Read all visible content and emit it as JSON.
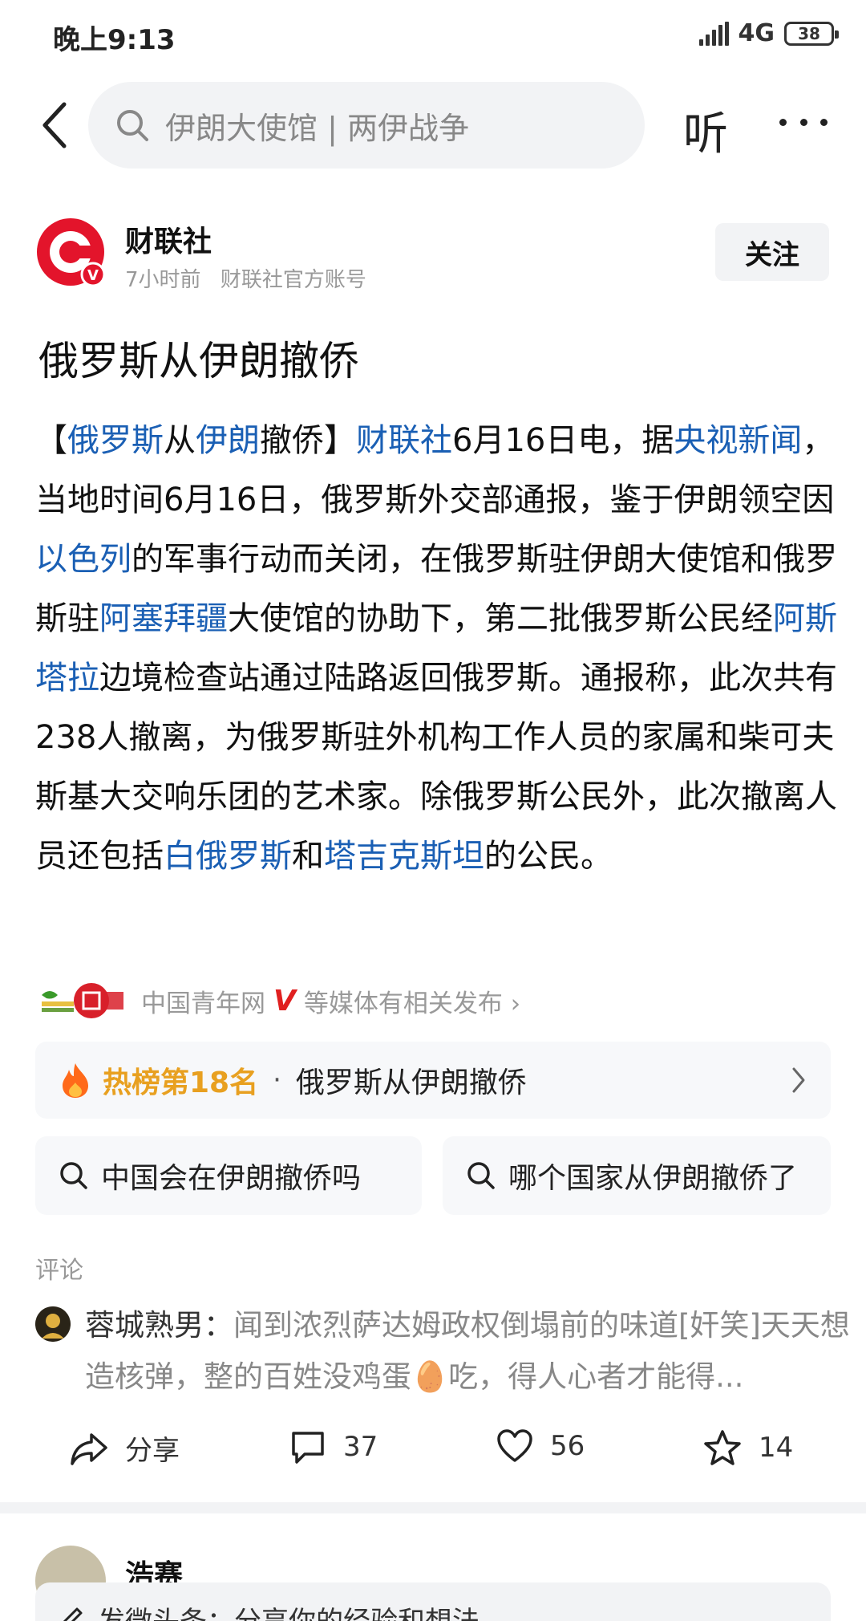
{
  "status_bar": {
    "time": "晚上9:13",
    "network": "4G",
    "battery": "38"
  },
  "top_bar": {
    "search_text": "伊朗大使馆 | 两伊战争",
    "listen_label": "听"
  },
  "author": {
    "name": "财联社",
    "time": "7小时前",
    "account_type": "财联社官方账号",
    "follow_label": "关注",
    "brand_color": "#e3142b"
  },
  "article": {
    "title": "俄罗斯从伊朗撤侨",
    "segments": [
      {
        "text": "【",
        "link": false
      },
      {
        "text": "俄罗斯",
        "link": true
      },
      {
        "text": "从",
        "link": false
      },
      {
        "text": "伊朗",
        "link": true
      },
      {
        "text": "撤侨】",
        "link": false
      },
      {
        "text": "财联社",
        "link": true
      },
      {
        "text": "6月16日电，据",
        "link": false
      },
      {
        "text": "央视新闻",
        "link": true
      },
      {
        "text": "，当地时间6月16日，俄罗斯外交部通报，鉴于伊朗领空因",
        "link": false
      },
      {
        "text": "以色列",
        "link": true
      },
      {
        "text": "的军事行动而关闭，在俄罗斯驻伊朗大使馆和俄罗斯驻",
        "link": false
      },
      {
        "text": "阿塞拜疆",
        "link": true
      },
      {
        "text": "大使馆的协助下，第二批俄罗斯公民经",
        "link": false
      },
      {
        "text": "阿斯塔拉",
        "link": true
      },
      {
        "text": "边境检查站通过陆路返回俄罗斯。通报称，此次共有238人撤离，为俄罗斯驻外机构工作人员的家属和柴可夫斯基大交响乐团的艺术家。除俄罗斯公民外，此次撤离人员还包括",
        "link": false
      },
      {
        "text": "白俄罗斯",
        "link": true
      },
      {
        "text": "和",
        "link": false
      },
      {
        "text": "塔吉克斯坦",
        "link": true
      },
      {
        "text": "的公民。",
        "link": false
      }
    ],
    "link_color": "#1a5fb4"
  },
  "source": {
    "name": "中国青年网",
    "v_mark": "V",
    "suffix": "等媒体有相关发布 ›"
  },
  "hot": {
    "rank_label": "热榜第18名",
    "dot": "·",
    "title": "俄罗斯从伊朗撤侨",
    "accent_color": "#e8a020"
  },
  "related": [
    {
      "text": "中国会在伊朗撤侨吗"
    },
    {
      "text": "哪个国家从伊朗撤侨了"
    }
  ],
  "comments": {
    "label": "评论",
    "first": {
      "user": "蓉城熟男：",
      "content": "闻到浓烈萨达姆政权倒塌前的味道[奸笑]天天想造核弹，整的百姓没鸡蛋🥚吃，得人心者才能得..."
    }
  },
  "actions": {
    "share_label": "分享",
    "comment_count": "37",
    "like_count": "56",
    "favorite_count": "14"
  },
  "next": {
    "author_name": "浩赛",
    "compose_placeholder": "发微头条：分享你的经验和想法"
  }
}
